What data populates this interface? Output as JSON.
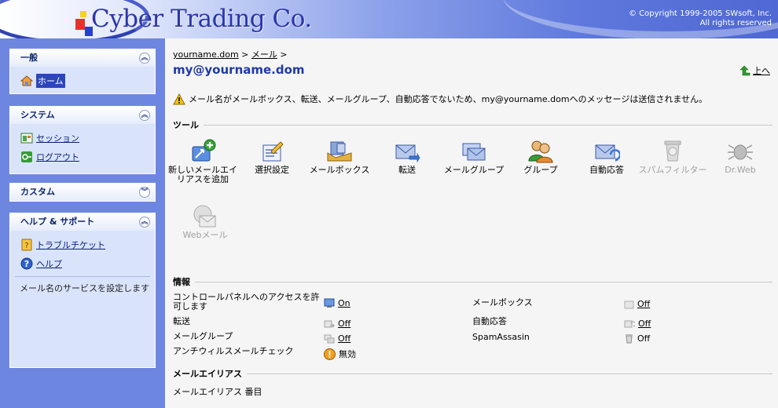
{
  "header": {
    "logo": "Cyber Trading Co.",
    "copyright_line1": "© Copyright 1999-2005 SWsoft, Inc.",
    "copyright_line2": "All rights reserved"
  },
  "sidebar": {
    "general": {
      "title": "一般",
      "items": [
        {
          "label": "ホーム",
          "icon": "home-icon"
        }
      ]
    },
    "system": {
      "title": "システム",
      "items": [
        {
          "label": "セッション",
          "icon": "session-icon"
        },
        {
          "label": "ログアウト",
          "icon": "logout-icon"
        }
      ]
    },
    "custom": {
      "title": "カスタム"
    },
    "help": {
      "title": "ヘルプ & サポート",
      "items": [
        {
          "label": "トラブルチケット",
          "icon": "ticket-icon"
        },
        {
          "label": "ヘルプ",
          "icon": "help-icon"
        }
      ],
      "note": "メール名のサービスを設定します"
    }
  },
  "main": {
    "breadcrumb": {
      "domain": "yourname.dom",
      "sep": ">",
      "mail": "メール"
    },
    "title": "my@yourname.dom",
    "up_label": "上へ",
    "warning": "メール名がメールボックス、転送、メールグループ、自動応答でないため、my@yourname.domへのメッセージは送信されません。",
    "tools_heading": "ツール",
    "tools": [
      {
        "label": "新しいメールエイリアスを追加",
        "enabled": true
      },
      {
        "label": "選択設定",
        "enabled": true
      },
      {
        "label": "メールボックス",
        "enabled": true
      },
      {
        "label": "転送",
        "enabled": true
      },
      {
        "label": "メールグループ",
        "enabled": true
      },
      {
        "label": "グループ",
        "enabled": true
      },
      {
        "label": "自動応答",
        "enabled": true
      },
      {
        "label": "スパムフィルター",
        "enabled": false
      },
      {
        "label": "Dr.Web",
        "enabled": false
      },
      {
        "label": "Webメール",
        "enabled": false
      }
    ],
    "info_heading": "情報",
    "info": {
      "cp_access_label": "コントロールパネルへのアクセスを許可します",
      "cp_access_value": "On",
      "mailbox_label": "メールボックス",
      "mailbox_value": "Off",
      "forward_label": "転送",
      "forward_value": "Off",
      "autoreply_label": "自動応答",
      "autoreply_value": "Off",
      "mailgroup_label": "メールグループ",
      "mailgroup_value": "Off",
      "spam_label": "SpamAssasin",
      "spam_value": "Off",
      "antivirus_label": "アンチウィルスメールチェック",
      "antivirus_value": "無効"
    },
    "alias_heading": "メールエイリアス",
    "alias_column": "メールエイリアス 番目"
  },
  "colors": {
    "accent": "#1f3aa8",
    "sidebar": "#6d87e0",
    "panel": "#d9e4fb"
  }
}
